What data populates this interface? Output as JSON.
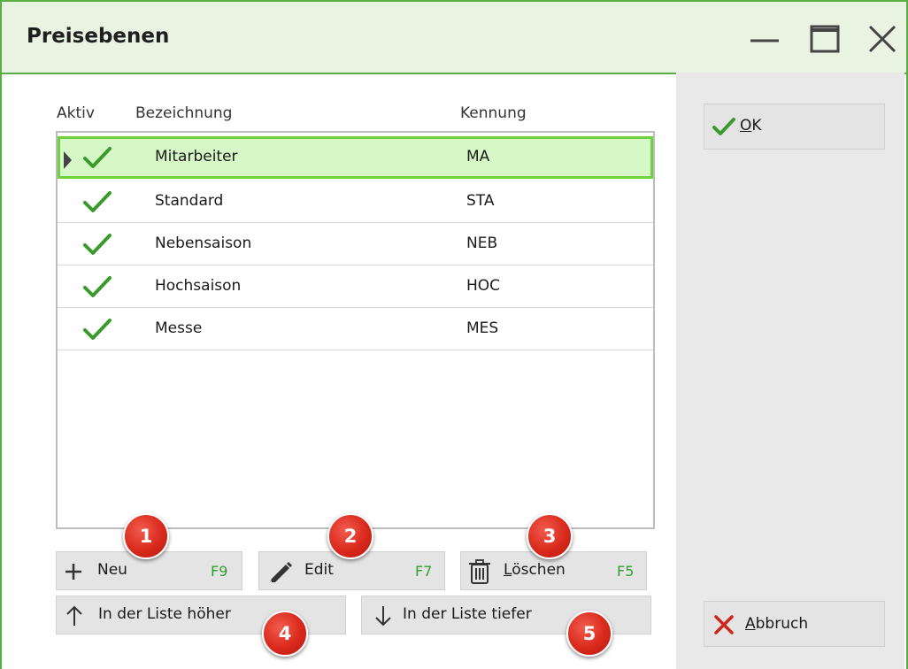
{
  "window": {
    "title": "Preisebenen"
  },
  "columns": {
    "aktiv": "Aktiv",
    "bezeichnung": "Bezeichnung",
    "kennung": "Kennung"
  },
  "rows": [
    {
      "name": "Mitarbeiter",
      "code": "MA",
      "active": true,
      "selected": true
    },
    {
      "name": "Standard",
      "code": "STA",
      "active": true,
      "selected": false
    },
    {
      "name": "Nebensaison",
      "code": "NEB",
      "active": true,
      "selected": false
    },
    {
      "name": "Hochsaison",
      "code": "HOC",
      "active": true,
      "selected": false
    },
    {
      "name": "Messe",
      "code": "MES",
      "active": true,
      "selected": false
    }
  ],
  "buttons": {
    "neu": {
      "label": "Neu",
      "key": "F9",
      "icon": "plus-icon"
    },
    "edit": {
      "label": "Edit",
      "key": "F7",
      "icon": "pencil-icon"
    },
    "loeschen": {
      "label_underlined": "L",
      "label_rest": "öschen",
      "key": "F5",
      "icon": "trash-icon"
    },
    "hoeher": {
      "label": "In der Liste höher",
      "icon": "arrow-up-icon"
    },
    "tiefer": {
      "label": "In der Liste tiefer",
      "icon": "arrow-down-icon"
    },
    "ok": {
      "label_underlined": "O",
      "label_rest": "K",
      "icon": "checkmark-icon"
    },
    "abbruch": {
      "label_underlined": "A",
      "label_rest": "bbruch",
      "icon": "x-icon"
    }
  },
  "badges": [
    "1",
    "2",
    "3",
    "4",
    "5"
  ],
  "colors": {
    "accent_green": "#5aac44",
    "selection_fill": "#d6f8c6",
    "selection_border": "#6fd23d",
    "check_green": "#3a9a2c",
    "badge_red": "#d9291c",
    "cancel_red": "#d0261a"
  }
}
